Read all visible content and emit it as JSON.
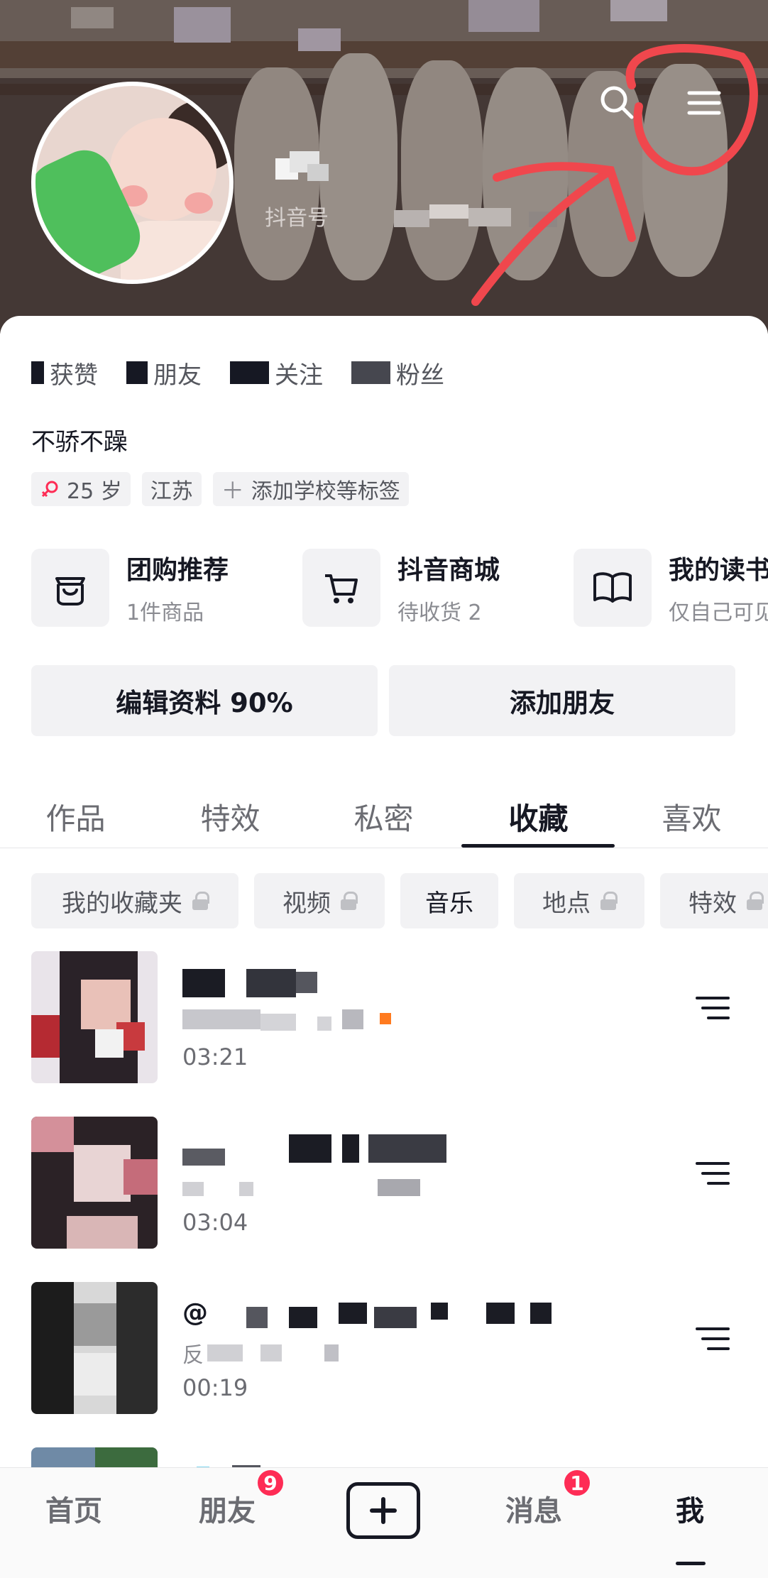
{
  "profile": {
    "douyin_id_label": "抖音号",
    "bio": "不骄不躁",
    "stats": [
      {
        "label": "获赞"
      },
      {
        "label": "朋友"
      },
      {
        "label": "关注"
      },
      {
        "label": "粉丝"
      }
    ],
    "tags": [
      {
        "icon": "female-icon",
        "label": "25 岁"
      },
      {
        "label": "江苏"
      },
      {
        "icon": "plus-icon",
        "label": "添加学校等标签"
      }
    ]
  },
  "header": {
    "icons": [
      "search-icon",
      "menu-icon"
    ]
  },
  "services": [
    {
      "icon": "group-buy-icon",
      "title": "团购推荐",
      "subtitle": "1件商品"
    },
    {
      "icon": "cart-icon",
      "title": "抖音商城",
      "subtitle": "待收货 2"
    },
    {
      "icon": "book-icon",
      "title": "我的读书",
      "subtitle": "仅自己可见"
    }
  ],
  "actions": {
    "edit_profile": "编辑资料 90%",
    "add_friend": "添加朋友"
  },
  "tabs": [
    {
      "label": "作品"
    },
    {
      "label": "特效"
    },
    {
      "label": "私密"
    },
    {
      "label": "收藏",
      "active": true
    },
    {
      "label": "喜欢"
    }
  ],
  "chips": [
    {
      "label": "我的收藏夹",
      "locked": true
    },
    {
      "label": "视频",
      "locked": true
    },
    {
      "label": "音乐",
      "locked": false,
      "active": true
    },
    {
      "label": "地点",
      "locked": true
    },
    {
      "label": "特效",
      "locked": true
    }
  ],
  "music_list": [
    {
      "duration": "03:21"
    },
    {
      "duration": "03:04"
    },
    {
      "title_prefix": "@",
      "sub_prefix": "反",
      "duration": "00:19"
    }
  ],
  "bottom_nav": [
    {
      "label": "首页"
    },
    {
      "label": "朋友",
      "badge": "9"
    },
    {
      "icon": "plus-icon"
    },
    {
      "label": "消息",
      "badge": "1"
    },
    {
      "label": "我",
      "active": true
    }
  ],
  "colors": {
    "accent_red": "#fe2c55",
    "annotation_red": "#f0474d",
    "text_primary": "#161823",
    "chip_bg": "#f2f2f4"
  }
}
